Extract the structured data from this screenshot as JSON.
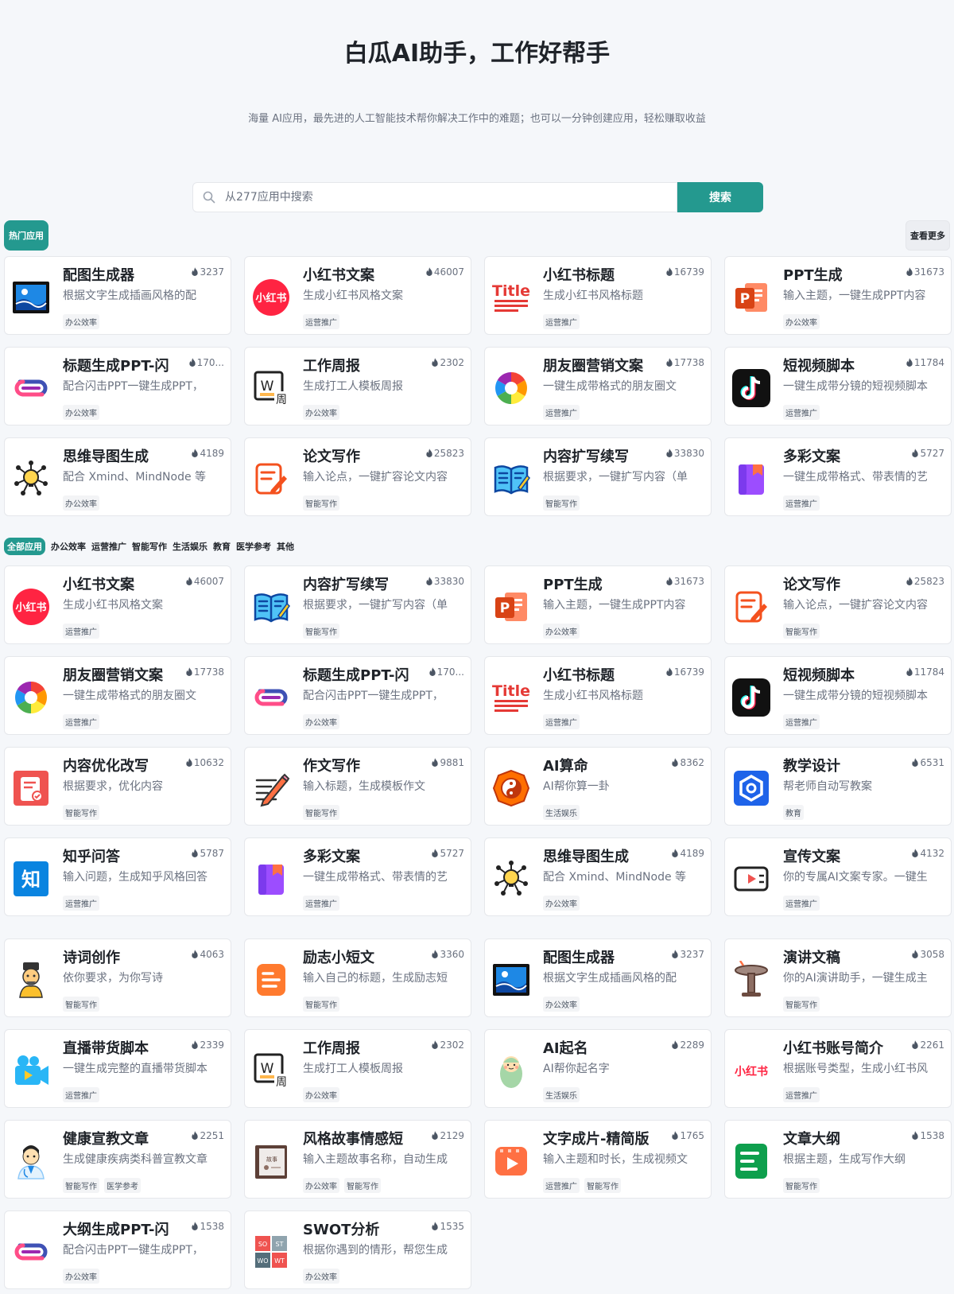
{
  "hero": {
    "title": "白瓜AI助手，工作好帮手",
    "subtitle": "海量 AI应用，最先进的人工智能技术帮你解决工作中的难题；也可以一分钟创建应用，轻松赚取收益"
  },
  "search": {
    "placeholder": "从277应用中搜索",
    "button": "搜索"
  },
  "hot": {
    "badge": "热门应用",
    "more": "查看更多",
    "cards": [
      {
        "name": "配图生成器",
        "count": "3237",
        "desc": "根据文字生成插画风格的配",
        "tags": [
          "办公效率"
        ],
        "icon": "picture"
      },
      {
        "name": "小红书文案",
        "count": "46007",
        "desc": "生成小红书风格文案",
        "tags": [
          "运营推广"
        ],
        "icon": "xhs-round"
      },
      {
        "name": "小红书标题",
        "count": "16739",
        "desc": "生成小红书风格标题",
        "tags": [
          "运营推广"
        ],
        "icon": "title"
      },
      {
        "name": "PPT生成",
        "count": "31673",
        "desc": "输入主题，一键生成PPT内容",
        "tags": [
          "办公效率"
        ],
        "icon": "ppt"
      },
      {
        "name": "标题生成PPT-闪",
        "count": "170...",
        "desc": "配合闪击PPT一键生成PPT，",
        "tags": [
          "办公效率"
        ],
        "icon": "flash"
      },
      {
        "name": "工作周报",
        "count": "2302",
        "desc": "生成打工人模板周报",
        "tags": [
          "办公效率"
        ],
        "icon": "weekly"
      },
      {
        "name": "朋友圈营销文案",
        "count": "17738",
        "desc": "一键生成带格式的朋友圈文",
        "tags": [
          "运营推广"
        ],
        "icon": "moments"
      },
      {
        "name": "短视频脚本",
        "count": "11784",
        "desc": "一键生成带分镜的短视频脚本",
        "tags": [
          "运营推广"
        ],
        "icon": "tiktok"
      },
      {
        "name": "思维导图生成",
        "count": "4189",
        "desc": "配合 Xmind、MindNode 等",
        "tags": [
          "办公效率"
        ],
        "icon": "mindmap"
      },
      {
        "name": "论文写作",
        "count": "25823",
        "desc": "输入论点，一键扩容论文内容",
        "tags": [
          "智能写作"
        ],
        "icon": "paper"
      },
      {
        "name": "内容扩写续写",
        "count": "33830",
        "desc": "根据要求，一键扩写内容（单",
        "tags": [
          "智能写作"
        ],
        "icon": "book"
      },
      {
        "name": "多彩文案",
        "count": "5727",
        "desc": "一键生成带格式、带表情的艺",
        "tags": [
          "运营推广"
        ],
        "icon": "colorful"
      }
    ]
  },
  "categories": [
    "全部应用",
    "办公效率",
    "运营推广",
    "智能写作",
    "生活娱乐",
    "教育",
    "医学参考",
    "其他"
  ],
  "all": {
    "cards": [
      {
        "name": "小红书文案",
        "count": "46007",
        "desc": "生成小红书风格文案",
        "tags": [
          "运营推广"
        ],
        "icon": "xhs-round"
      },
      {
        "name": "内容扩写续写",
        "count": "33830",
        "desc": "根据要求，一键扩写内容（单",
        "tags": [
          "智能写作"
        ],
        "icon": "book"
      },
      {
        "name": "PPT生成",
        "count": "31673",
        "desc": "输入主题，一键生成PPT内容",
        "tags": [
          "办公效率"
        ],
        "icon": "ppt"
      },
      {
        "name": "论文写作",
        "count": "25823",
        "desc": "输入论点，一键扩容论文内容",
        "tags": [
          "智能写作"
        ],
        "icon": "paper"
      },
      {
        "name": "朋友圈营销文案",
        "count": "17738",
        "desc": "一键生成带格式的朋友圈文",
        "tags": [
          "运营推广"
        ],
        "icon": "moments"
      },
      {
        "name": "标题生成PPT-闪",
        "count": "170...",
        "desc": "配合闪击PPT一键生成PPT，",
        "tags": [
          "办公效率"
        ],
        "icon": "flash"
      },
      {
        "name": "小红书标题",
        "count": "16739",
        "desc": "生成小红书风格标题",
        "tags": [
          "运营推广"
        ],
        "icon": "title"
      },
      {
        "name": "短视频脚本",
        "count": "11784",
        "desc": "一键生成带分镜的短视频脚本",
        "tags": [
          "运营推广"
        ],
        "icon": "tiktok"
      },
      {
        "name": "内容优化改写",
        "count": "10632",
        "desc": "根据要求，优化内容",
        "tags": [
          "智能写作"
        ],
        "icon": "optimize"
      },
      {
        "name": "作文写作",
        "count": "9881",
        "desc": "输入标题，生成模板作文",
        "tags": [
          "智能写作"
        ],
        "icon": "pencil"
      },
      {
        "name": "AI算命",
        "count": "8362",
        "desc": "AI帮你算一卦",
        "tags": [
          "生活娱乐"
        ],
        "icon": "bagua"
      },
      {
        "name": "教学设计",
        "count": "6531",
        "desc": "帮老师自动写教案",
        "tags": [
          "教育"
        ],
        "icon": "teach"
      },
      {
        "name": "知乎问答",
        "count": "5787",
        "desc": "输入问题，生成知乎风格回答",
        "tags": [
          "运营推广"
        ],
        "icon": "zhihu"
      },
      {
        "name": "多彩文案",
        "count": "5727",
        "desc": "一键生成带格式、带表情的艺",
        "tags": [
          "运营推广"
        ],
        "icon": "colorful"
      },
      {
        "name": "思维导图生成",
        "count": "4189",
        "desc": "配合 Xmind、MindNode 等",
        "tags": [
          "办公效率"
        ],
        "icon": "mindmap"
      },
      {
        "name": "宣传文案",
        "count": "4132",
        "desc": "你的专属AI文案专家。一键生",
        "tags": [
          "运营推广"
        ],
        "icon": "promo"
      }
    ]
  },
  "all2": {
    "cards": [
      {
        "name": "诗词创作",
        "count": "4063",
        "desc": "依你要求，为你写诗",
        "tags": [
          "智能写作"
        ],
        "icon": "poet"
      },
      {
        "name": "励志小短文",
        "count": "3360",
        "desc": "输入自己的标题，生成励志短",
        "tags": [
          "智能写作"
        ],
        "icon": "doc-orange"
      },
      {
        "name": "配图生成器",
        "count": "3237",
        "desc": "根据文字生成插画风格的配",
        "tags": [
          "办公效率"
        ],
        "icon": "picture"
      },
      {
        "name": "演讲文稿",
        "count": "3058",
        "desc": "你的AI演讲助手，一键生成主",
        "tags": [
          "智能写作"
        ],
        "icon": "podium"
      },
      {
        "name": "直播带货脚本",
        "count": "2339",
        "desc": "一键生成完整的直播带货脚本",
        "tags": [
          "运营推广"
        ],
        "icon": "camera"
      },
      {
        "name": "工作周报",
        "count": "2302",
        "desc": "生成打工人模板周报",
        "tags": [
          "办公效率"
        ],
        "icon": "weekly"
      },
      {
        "name": "AI起名",
        "count": "2289",
        "desc": "AI帮你起名字",
        "tags": [
          "生活娱乐"
        ],
        "icon": "baby"
      },
      {
        "name": "小红书账号简介",
        "count": "2261",
        "desc": "根据账号类型，生成小红书风",
        "tags": [
          "运营推广"
        ],
        "icon": "xhs-text"
      },
      {
        "name": "健康宣教文章",
        "count": "2251",
        "desc": "生成健康疾病类科普宣教文章",
        "tags": [
          "智能写作",
          "医学参考"
        ],
        "icon": "doctor"
      },
      {
        "name": "风格故事情感短",
        "count": "2129",
        "desc": "输入主题故事名称，自动生成",
        "tags": [
          "办公效率",
          "智能写作"
        ],
        "icon": "storybook"
      },
      {
        "name": "文字成片-精简版",
        "count": "1765",
        "desc": "输入主题和时长，生成视频文",
        "tags": [
          "运营推广",
          "智能写作"
        ],
        "icon": "video"
      },
      {
        "name": "文章大纲",
        "count": "1538",
        "desc": "根据主题，生成写作大纲",
        "tags": [
          "智能写作"
        ],
        "icon": "outline"
      },
      {
        "name": "大纲生成PPT-闪",
        "count": "1538",
        "desc": "配合闪击PPT一键生成PPT，",
        "tags": [
          "办公效率"
        ],
        "icon": "flash"
      },
      {
        "name": "SWOT分析",
        "count": "1535",
        "desc": "根据你遇到的情形，帮您生成",
        "tags": [
          "办公效率"
        ],
        "icon": "swot"
      }
    ]
  }
}
